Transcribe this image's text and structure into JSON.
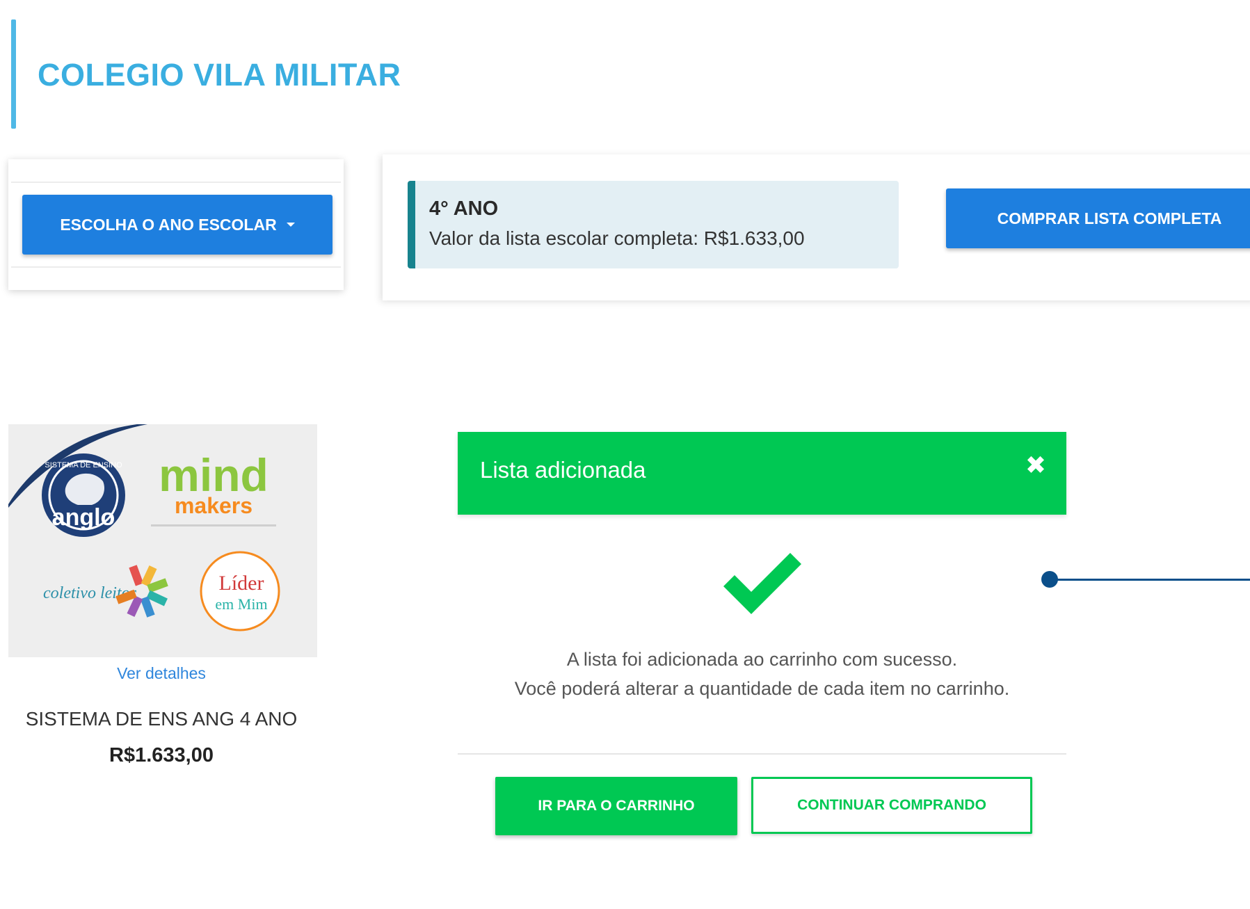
{
  "header": {
    "title": "COLEGIO VILA MILITAR"
  },
  "year_selector": {
    "button_label": "ESCOLHA O ANO ESCOLAR"
  },
  "list_info": {
    "grade": "4° ANO",
    "total_text": "Valor da lista escolar completa: R$1.633,00",
    "buy_button_label": "COMPRAR LISTA COMPLETA"
  },
  "product": {
    "logos": {
      "anglo": "anglo",
      "anglo_ring": "SISTEMA DE ENSINO",
      "mind": "mind",
      "makers": "makers",
      "coletivo": "coletivo leitor",
      "lider": "Líder",
      "em_mim": "em Mim"
    },
    "details_link": "Ver detalhes",
    "name": "SISTEMA DE ENS ANG 4 ANO",
    "price": "R$1.633,00"
  },
  "modal": {
    "title": "Lista adicionada",
    "message_line1": "A lista foi adicionada ao carrinho com sucesso.",
    "message_line2": "Você poderá alterar a quantidade de cada item no carrinho.",
    "go_to_cart_label": "IR PARA O CARRINHO",
    "continue_label": "CONTINUAR COMPRANDO"
  },
  "colors": {
    "primary_blue": "#1e7fdf",
    "title_blue": "#3aaee0",
    "success_green": "#00c853",
    "teal_accent": "#17838e",
    "annotation_navy": "#0b4f8a"
  },
  "icons": [
    "caret-down-icon",
    "close-icon",
    "check-icon"
  ]
}
